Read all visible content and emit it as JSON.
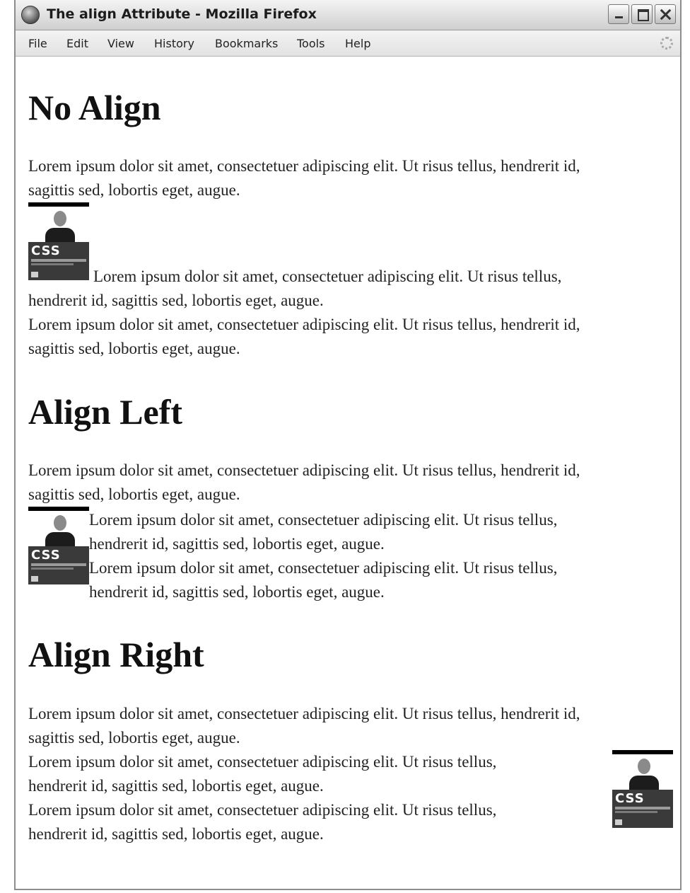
{
  "window": {
    "title": "The align Attribute - Mozilla Firefox"
  },
  "menu": [
    "File",
    "Edit",
    "View",
    "History",
    "Bookmarks",
    "Tools",
    "Help"
  ],
  "image": {
    "cover_text": "CSS"
  },
  "sections": {
    "no_align": {
      "heading": "No Align",
      "p1": [
        "Lorem ipsum dolor sit amet, consectetuer adipiscing elit. Ut risus tellus, hendrerit id,",
        "sagittis sed, lobortis eget, augue."
      ],
      "p2": [
        "Lorem ipsum dolor sit amet, consectetuer adipiscing elit. Ut risus tellus,",
        "hendrerit id, sagittis sed, lobortis eget, augue."
      ],
      "p3": [
        "Lorem ipsum dolor sit amet, consectetuer adipiscing elit. Ut risus tellus, hendrerit id,",
        "sagittis sed, lobortis eget, augue."
      ]
    },
    "align_left": {
      "heading": "Align Left",
      "p1": [
        "Lorem ipsum dolor sit amet, consectetuer adipiscing elit. Ut risus tellus, hendrerit id,",
        "sagittis sed, lobortis eget, augue."
      ],
      "p2": [
        "Lorem ipsum dolor sit amet, consectetuer adipiscing elit. Ut risus tellus,",
        "hendrerit id, sagittis sed, lobortis eget, augue."
      ],
      "p3": [
        "Lorem ipsum dolor sit amet, consectetuer adipiscing elit. Ut risus tellus,",
        "hendrerit id, sagittis sed, lobortis eget, augue."
      ]
    },
    "align_right": {
      "heading": "Align Right",
      "p1": [
        "Lorem ipsum dolor sit amet, consectetuer adipiscing elit. Ut risus tellus, hendrerit id,",
        "sagittis sed, lobortis eget, augue."
      ],
      "p2": [
        "Lorem ipsum dolor sit amet, consectetuer adipiscing elit. Ut risus tellus,",
        "hendrerit id, sagittis sed, lobortis eget, augue."
      ],
      "p3": [
        "Lorem ipsum dolor sit amet, consectetuer adipiscing elit. Ut risus tellus,",
        "hendrerit id, sagittis sed, lobortis eget, augue."
      ]
    }
  }
}
